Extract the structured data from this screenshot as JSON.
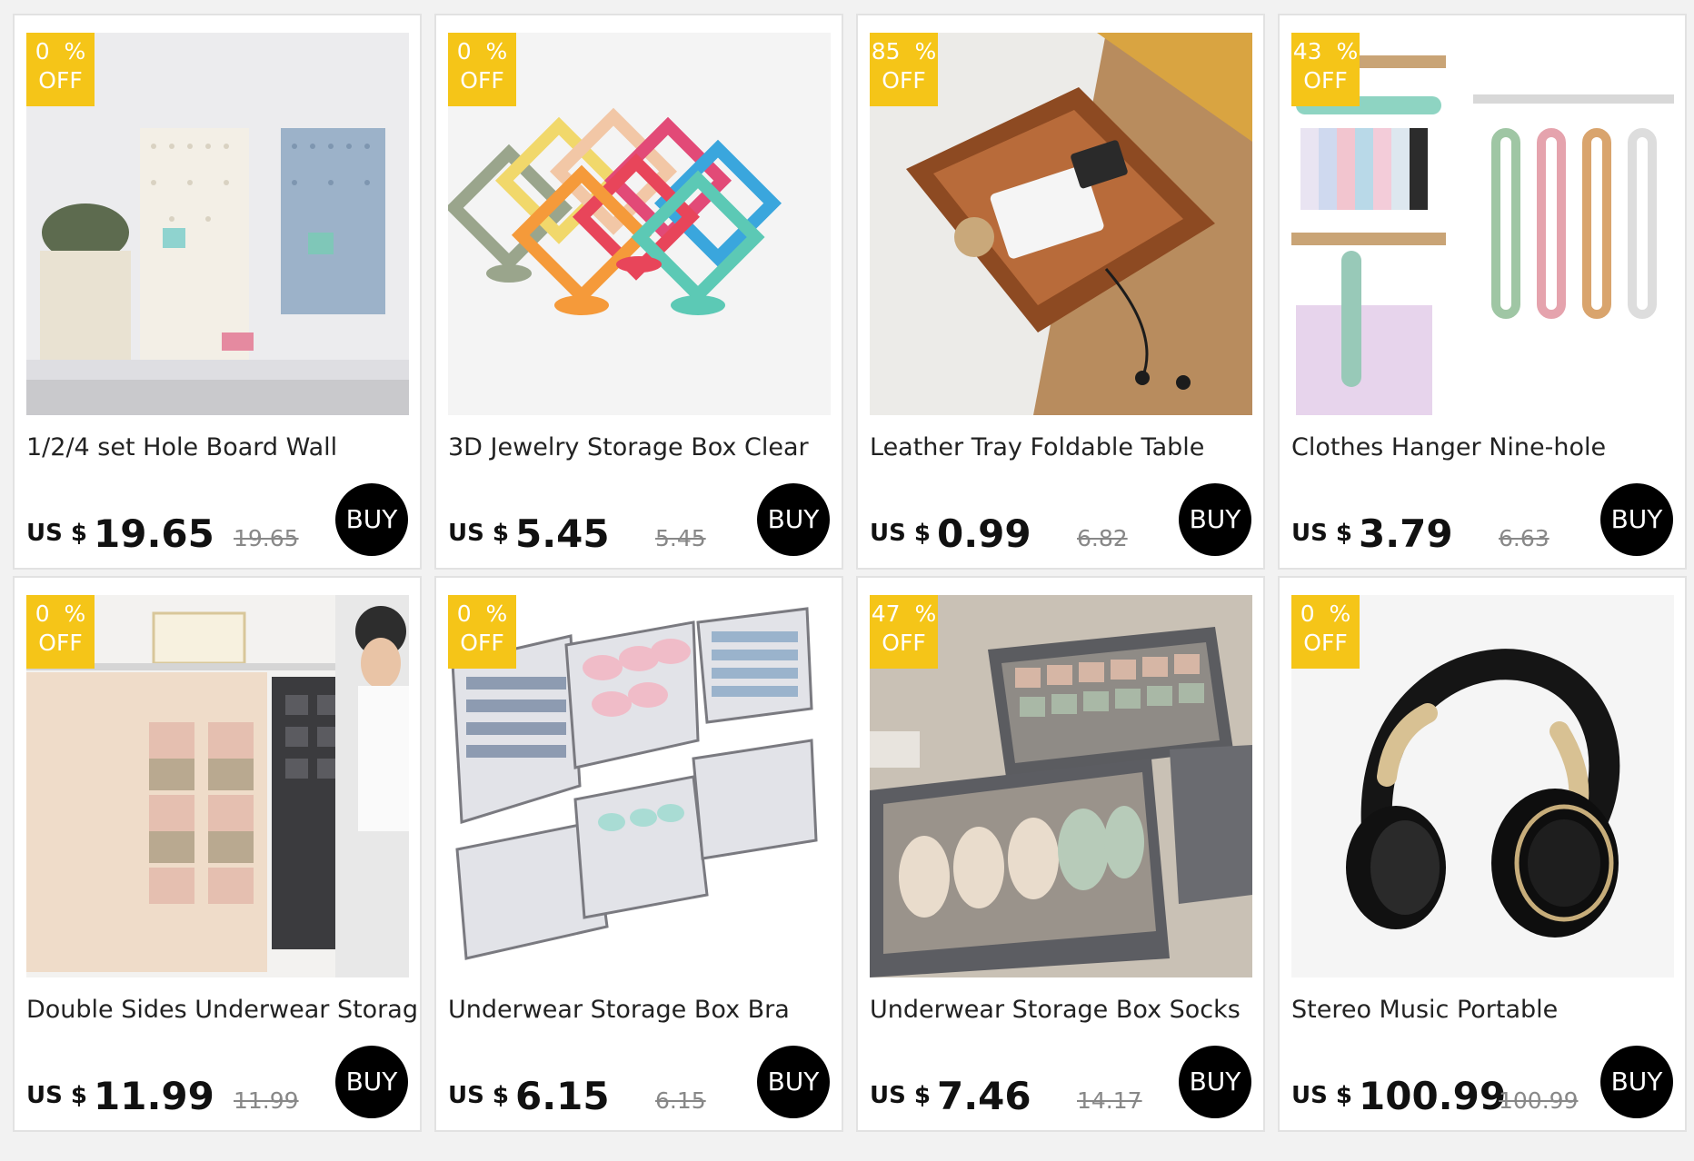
{
  "products": [
    {
      "title": "1/2/4 set Hole Board Wall",
      "discount": "0  %",
      "off": "OFF",
      "currency": "US $",
      "price": "19.65",
      "old_price": "19.65",
      "buy": "BUY",
      "image": "pegboard-wall-photo"
    },
    {
      "title": "3D Jewelry Storage Box Clear",
      "discount": "0  %",
      "off": "OFF",
      "currency": "US $",
      "price": "5.45",
      "old_price": "5.45",
      "buy": "BUY",
      "image": "jewelry-frames-photo"
    },
    {
      "title": "Leather Tray Foldable Table",
      "discount": "85  %",
      "off": "OFF",
      "currency": "US $",
      "price": "0.99",
      "old_price": "6.82",
      "buy": "BUY",
      "image": "leather-tray-photo"
    },
    {
      "title": "Clothes Hanger Nine-hole",
      "discount": "43  %",
      "off": "OFF",
      "currency": "US $",
      "price": "3.79",
      "old_price": "6.63",
      "buy": "BUY",
      "image": "clothes-hanger-photo"
    },
    {
      "title": "Double Sides Underwear Storage",
      "discount": "0  %",
      "off": "OFF",
      "currency": "US $",
      "price": "11.99",
      "old_price": "11.99",
      "buy": "BUY",
      "image": "hanging-organizer-photo"
    },
    {
      "title": "Underwear Storage Box Bra",
      "discount": "0  %",
      "off": "OFF",
      "currency": "US $",
      "price": "6.15",
      "old_price": "6.15",
      "buy": "BUY",
      "image": "mesh-storage-boxes-photo"
    },
    {
      "title": "Underwear Storage Box Socks",
      "discount": "47  %",
      "off": "OFF",
      "currency": "US $",
      "price": "7.46",
      "old_price": "14.17",
      "buy": "BUY",
      "image": "fabric-storage-boxes-photo"
    },
    {
      "title": "Stereo Music Portable",
      "discount": "0  %",
      "off": "OFF",
      "currency": "US $",
      "price": "100.99",
      "old_price": "100.99",
      "buy": "BUY",
      "image": "headphones-photo"
    }
  ],
  "colors": {
    "badge": "#f5c518",
    "buy_button": "#000000",
    "card_border": "#e2e2e2",
    "background": "#f2f2f2"
  }
}
